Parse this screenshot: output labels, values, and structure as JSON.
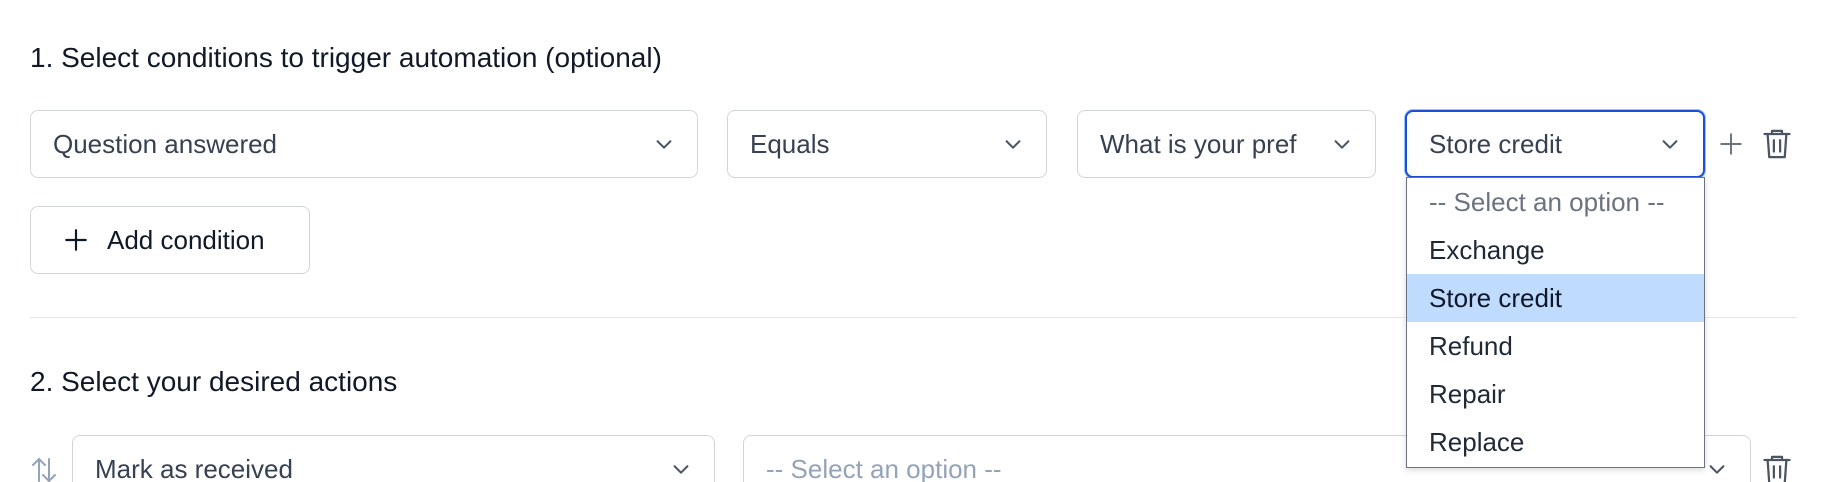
{
  "section1": {
    "title": "1. Select conditions to trigger automation (optional)",
    "condition": {
      "question": "Question answered",
      "operator": "Equals",
      "field": "What is your pref",
      "value": "Store credit"
    },
    "add_condition_label": "Add condition"
  },
  "section2": {
    "title": "2. Select your desired actions",
    "action": {
      "type": "Mark as received",
      "option_placeholder": "-- Select an option --"
    }
  },
  "dropdown": {
    "options": [
      "-- Select an option --",
      "Exchange",
      "Store credit",
      "Refund",
      "Repair",
      "Replace"
    ],
    "selected_index": 2
  },
  "icons": {
    "chevron": "chevron-down-icon",
    "plus": "plus-icon",
    "trash": "trash-icon",
    "sort": "sort-arrows-icon"
  },
  "colors": {
    "focus_border": "#1d4ed8",
    "selected_option_bg": "#bfdbfe",
    "border": "#d1d5db",
    "muted_text": "#94a3b8"
  }
}
